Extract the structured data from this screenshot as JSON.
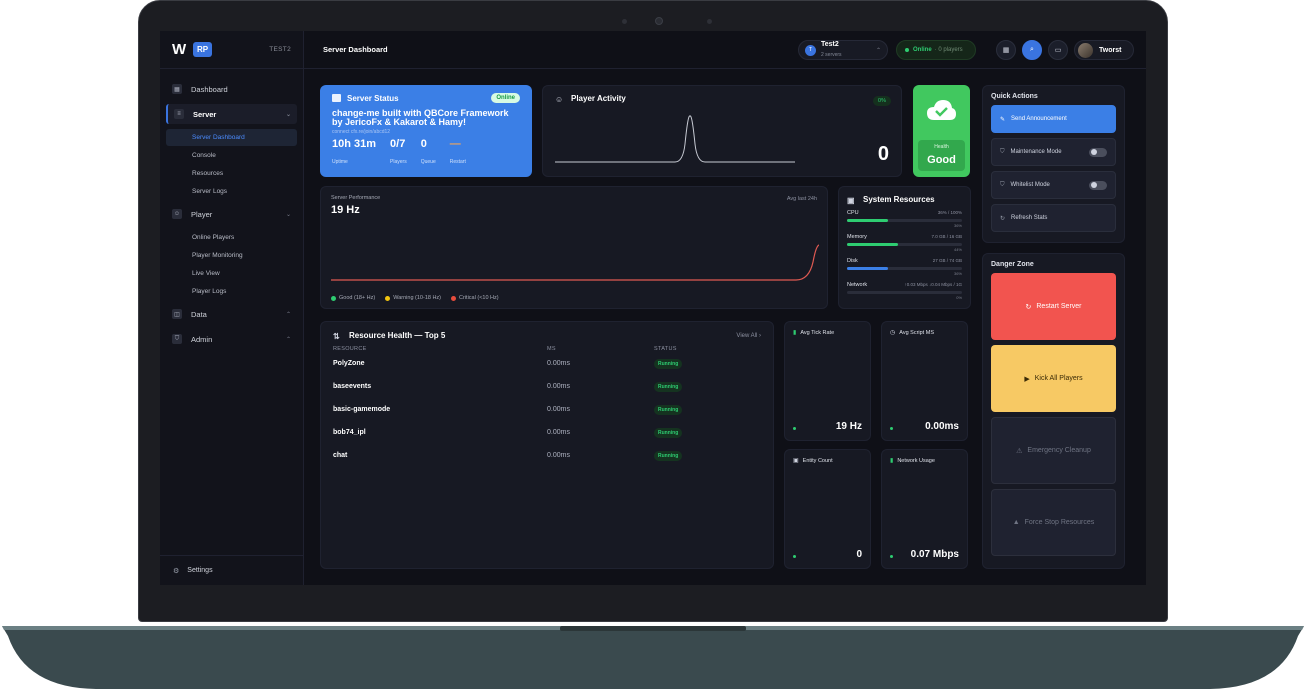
{
  "brand": {
    "logo": "W",
    "badge": "RP",
    "server_code": "TEST2"
  },
  "sidebar": {
    "items": [
      {
        "label": "Dashboard",
        "icon": "grid-icon"
      },
      {
        "label": "Server",
        "icon": "server-icon",
        "sub": [
          "Server Dashboard",
          "Console",
          "Resources",
          "Server Logs"
        ]
      },
      {
        "label": "Player",
        "icon": "users-icon",
        "sub": [
          "Online Players",
          "Player Monitoring",
          "Live View",
          "Player Logs"
        ]
      },
      {
        "label": "Data",
        "icon": "database-icon"
      },
      {
        "label": "Admin",
        "icon": "shield-icon"
      }
    ],
    "settings": "Settings"
  },
  "topbar": {
    "title": "Server Dashboard",
    "server_name": "Test2",
    "server_count": "2 servers",
    "server_initial": "T",
    "online_label": "Online",
    "online_sub": "· 0 players",
    "user_name": "Tworst"
  },
  "status": {
    "title": "Server Status",
    "badge": "Online",
    "name": "change-me built with QBCore Framework by JericoFx & Kakarot & Hamy!",
    "connect": "connect cfx.re/join/abcd12",
    "uptime": "10h 31m",
    "uptime_label": "Uptime",
    "players": "0/7",
    "players_label": "Players",
    "queue": "0",
    "queue_label": "Queue",
    "restart": "—",
    "restart_label": "Restart"
  },
  "activity": {
    "title": "Player Activity",
    "badge": "0%",
    "value": "0"
  },
  "health": {
    "label": "Health",
    "value": "Good",
    "color": "#41c85f"
  },
  "performance": {
    "label": "Server Performance",
    "value": "19 Hz",
    "avg": "Avg last 24h",
    "legend": [
      {
        "label": "Good (18+ Hz)",
        "color": "#2ecc71"
      },
      {
        "label": "Warning (10-18 Hz)",
        "color": "#f1c40f"
      },
      {
        "label": "Critical (<10 Hz)",
        "color": "#e74c3c"
      }
    ]
  },
  "system": {
    "title": "System Resources",
    "rows": [
      {
        "name": "CPU",
        "value": "36% / 100%",
        "pct": "36%",
        "fill": 0.36,
        "color": "#2ecc71"
      },
      {
        "name": "Memory",
        "value": "7.0 GB / 16 GB",
        "pct": "44%",
        "fill": 0.44,
        "color": "#2ecc71"
      },
      {
        "name": "Disk",
        "value": "27 GB / 74 GB",
        "pct": "36%",
        "fill": 0.36,
        "color": "#3b7fe6"
      },
      {
        "name": "Network",
        "value": "↑0.03 Mbps ↓0.04 Mbps / 1G",
        "pct": "0%",
        "fill": 0,
        "color": "#3b7fe6"
      }
    ]
  },
  "resource_health": {
    "title": "Resource Health — Top 5",
    "view_all": "View All",
    "headers": [
      "RESOURCE",
      "MS",
      "STATUS"
    ],
    "rows": [
      {
        "name": "PolyZone",
        "ms": "0.00ms",
        "status": "Running"
      },
      {
        "name": "baseevents",
        "ms": "0.00ms",
        "status": "Running"
      },
      {
        "name": "basic-gamemode",
        "ms": "0.00ms",
        "status": "Running"
      },
      {
        "name": "bob74_ipl",
        "ms": "0.00ms",
        "status": "Running"
      },
      {
        "name": "chat",
        "ms": "0.00ms",
        "status": "Running"
      }
    ]
  },
  "metrics": {
    "tick": {
      "label": "Avg Tick Rate",
      "value": "19 Hz"
    },
    "script": {
      "label": "Avg Script MS",
      "value": "0.00ms"
    },
    "entity": {
      "label": "Entity Count",
      "value": "0"
    },
    "network": {
      "label": "Network Usage",
      "value": "0.07 Mbps"
    }
  },
  "quick_actions": {
    "title": "Quick Actions",
    "announce": "Send Announcement",
    "maintenance": "Maintenance Mode",
    "whitelist": "Whitelist Mode",
    "refresh": "Refresh Stats"
  },
  "danger_zone": {
    "title": "Danger Zone",
    "restart": "Restart Server",
    "kick": "Kick All Players",
    "cleanup": "Emergency Cleanup",
    "force_stop": "Force Stop Resources"
  }
}
